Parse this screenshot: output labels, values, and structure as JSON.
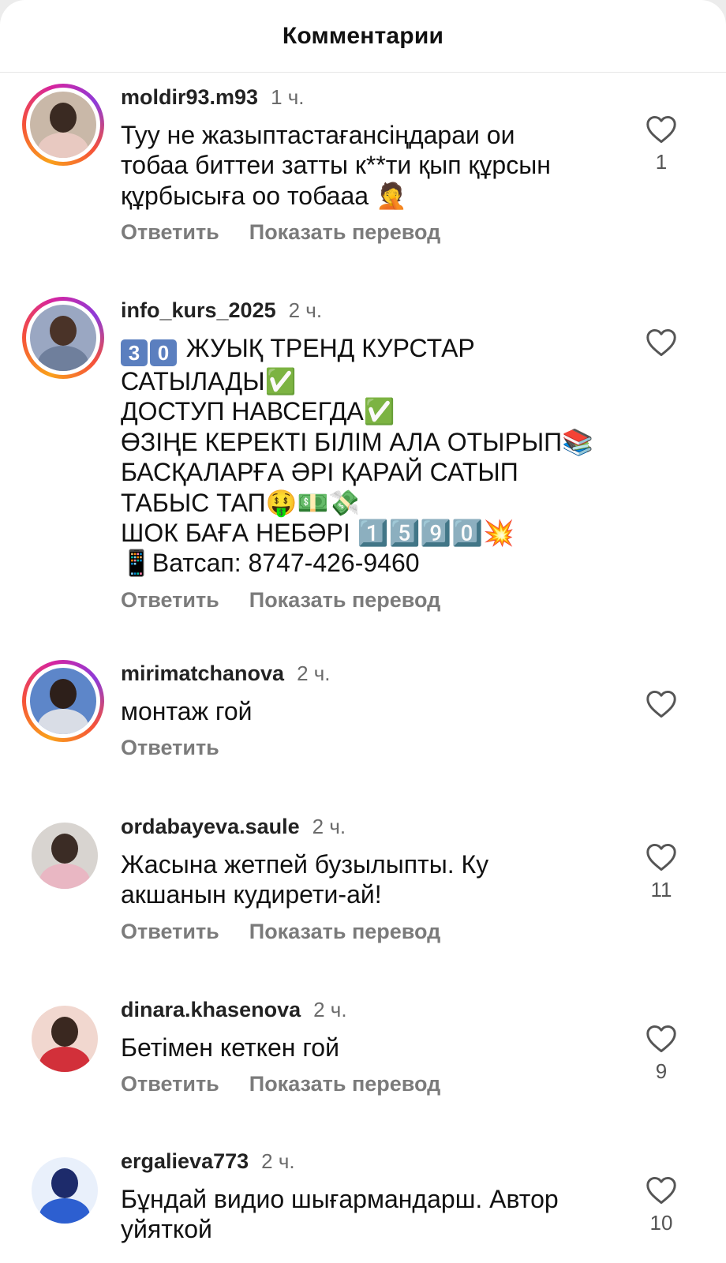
{
  "header": {
    "title": "Комментарии"
  },
  "actions": {
    "reply": "Ответить",
    "translate": "Показать перевод"
  },
  "comments": [
    {
      "username": "moldir93.m93",
      "time": "1 ч.",
      "text": "Туу не жазыптастағансіңдараи  ои\nтобаа биттеи затты к**ти қып құрсын\nқұрбысыға  оо тобааа 🤦",
      "likes": "1",
      "avatar_story_ring": true,
      "avatar_colors": {
        "bg": "#c9b8a8",
        "head": "#3a2a22",
        "body": "#e8c9c1"
      }
    },
    {
      "username": "info_kurs_2025",
      "time": "2 ч.",
      "text_prefix_badges": [
        "3",
        "0"
      ],
      "text": " ЖУЫҚ ТРЕНД КУРСТАР\nСАТЫЛАДЫ✅\nДОСТУП НАВСЕГДА✅\nӨЗІҢЕ КЕРЕКТІ БІЛІМ АЛА ОТЫРЫП📚\nБАСҚАЛАРҒА ӘРІ ҚАРАЙ САТЫП\nТАБЫС ТАП🤑💵💸\nШОК БАҒА НЕБӘРІ 1️⃣5️⃣9️⃣0️⃣💥\n📱Ватсап: 8747-426-9460",
      "likes": "",
      "avatar_story_ring": true,
      "avatar_colors": {
        "bg": "#9aa7c2",
        "head": "#4a3328",
        "body": "#6f7f9c"
      }
    },
    {
      "username": "mirimatchanova",
      "time": "2 ч.",
      "text": "монтаж гой",
      "likes": "",
      "show_translate": false,
      "avatar_story_ring": true,
      "avatar_colors": {
        "bg": "#5d86c9",
        "head": "#2d1f1a",
        "body": "#d9dde6"
      }
    },
    {
      "username": "ordabayeva.saule",
      "time": "2 ч.",
      "text": "Жасына жетпей бузылыпты. Ку\nакшанын кудирети-ай!",
      "likes": "11",
      "avatar_story_ring": false,
      "avatar_colors": {
        "bg": "#d8d4d0",
        "head": "#3b2c25",
        "body": "#e9b7c3"
      }
    },
    {
      "username": "dinara.khasenova",
      "time": "2 ч.",
      "text": "Бетімен кеткен гой",
      "likes": "9",
      "avatar_story_ring": false,
      "avatar_colors": {
        "bg": "#f1d7cf",
        "head": "#3a2820",
        "body": "#d2303a"
      }
    },
    {
      "username": "ergalieva773",
      "time": "2 ч.",
      "text": "Бұндай видио шығармандарш. Автор\nуйяткой",
      "likes": "10",
      "avatar_story_ring": false,
      "avatar_colors": {
        "bg": "#e9f0fb",
        "head": "#1d2b6b",
        "body": "#2d5fd0"
      }
    }
  ]
}
